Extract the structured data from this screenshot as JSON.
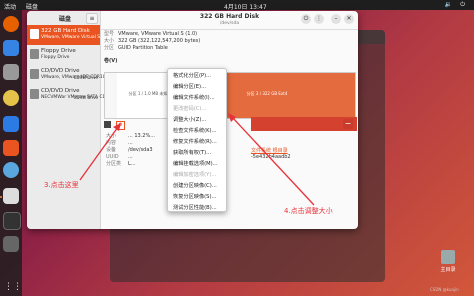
{
  "topbar": {
    "activities": "活动",
    "app_name": "磁盘",
    "clock": "4月10日 13:47",
    "tray": "🔉 ⏻"
  },
  "sidebar": {
    "title": "磁盘",
    "menu_glyph": "≡",
    "drives": [
      {
        "name": "322 GB Hard Disk",
        "sub": "VMware, VMware Virtual S",
        "extra": ""
      },
      {
        "name": "Floppy Drive",
        "sub": "Floppy Drive",
        "extra": ""
      },
      {
        "name": "CD/DVD Drive",
        "sub": "VMware, VMware IDE CDR10",
        "extra": "CDRW Drive"
      },
      {
        "name": "CD/DVD Drive",
        "sub": "NECVMWar VMware SATA CD01",
        "extra": "CDRW Drive"
      }
    ]
  },
  "header": {
    "title": "322 GB Hard Disk",
    "subtitle": "/dev/sda",
    "power_glyph": "⏻",
    "menu_glyph": "⋮",
    "min_glyph": "–",
    "close_glyph": "✕"
  },
  "disk_info": [
    {
      "k": "型号",
      "v": "VMware, VMware Virtual S (1.0)"
    },
    {
      "k": "大小",
      "v": "322 GB (322,122,547,200 bytes)"
    },
    {
      "k": "分区",
      "v": "GUID Partition Table"
    }
  ],
  "volumes_label": "卷(V)",
  "segments": {
    "p1": "分区 1 / 1.0 MB 未知",
    "p3": "分区 3 / 322 GB Ext4"
  },
  "details": [
    {
      "k": "大小",
      "v": "... 13.2%..."
    },
    {
      "k": "内容",
      "v": "..."
    },
    {
      "k": "设备",
      "v": "/dev/sda3"
    },
    {
      "k": "UUID",
      "v": "..."
    },
    {
      "k": "分区类",
      "v": "L..."
    }
  ],
  "mount_text": "文件系统 根目录",
  "uuid_tail": "-5e432b4aadb2",
  "menu_items": [
    {
      "label": "格式化分区(P)...",
      "disabled": false
    },
    {
      "label": "编辑分区(E)...",
      "disabled": false
    },
    {
      "label": "编辑文件系统(I)...",
      "disabled": false
    },
    {
      "label": "更改密码(C)...",
      "disabled": true
    },
    {
      "label": "调整大小(Z)...",
      "disabled": false
    },
    {
      "label": "检查文件系统(K)...",
      "disabled": false
    },
    {
      "label": "修复文件系统(R)...",
      "disabled": false
    },
    {
      "label": "获取所有权(T)...",
      "disabled": false
    },
    {
      "label": "编辑挂载选项(M)...",
      "disabled": false
    },
    {
      "label": "编辑加密选项(Y)...",
      "disabled": true
    },
    {
      "label": "创建分区映像(C)...",
      "disabled": false
    },
    {
      "label": "恢复分区映像(S)...",
      "disabled": false
    },
    {
      "label": "测试分区性能(B)...",
      "disabled": false
    }
  ],
  "annotations": {
    "step3": "3.点击这里",
    "step4": "4.点击调整大小"
  },
  "trash_label": "主目录",
  "watermark": "CSDN @kuajin",
  "accent": "#e95420",
  "annotation_color": "#e8323a"
}
